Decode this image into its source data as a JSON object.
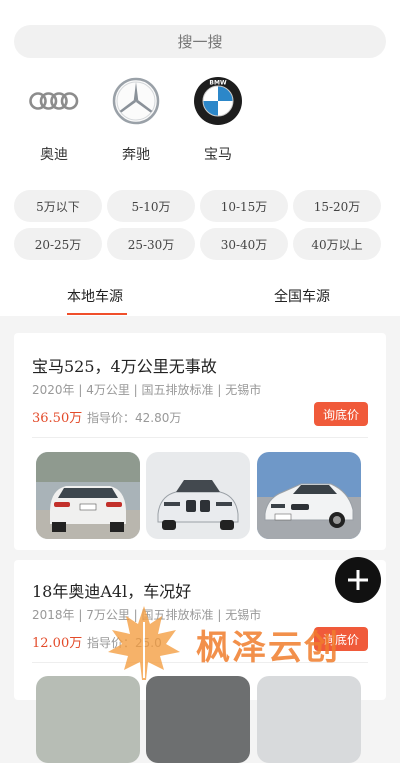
{
  "search": {
    "placeholder": "搜一搜"
  },
  "brands": [
    {
      "name": "奥迪",
      "icon": "audi-logo-icon"
    },
    {
      "name": "奔驰",
      "icon": "mercedes-logo-icon"
    },
    {
      "name": "宝马",
      "icon": "bmw-logo-icon"
    }
  ],
  "price_filters": [
    "5万以下",
    "5-10万",
    "10-15万",
    "15-20万",
    "20-25万",
    "25-30万",
    "30-40万",
    "40万以上"
  ],
  "tabs": [
    {
      "label": "本地车源",
      "active": true
    },
    {
      "label": "全国车源",
      "active": false
    }
  ],
  "listings": [
    {
      "title": "宝马525，4万公里无事故",
      "meta": "2020年 | 4万公里 | 国五排放标准 | 无锡市",
      "price": "36.50万",
      "guide": "指导价：42.80万",
      "action": "询底价"
    },
    {
      "title": "18年奥迪A4l，车况好",
      "meta": "2018年 | 7万公里 | 国五排放标准 | 无锡市",
      "price": "12.00万",
      "guide": "指导价：25.0",
      "action": "询底价"
    }
  ],
  "fab": {
    "icon": "plus-icon"
  },
  "watermark": {
    "text": "枫泽云创"
  },
  "colors": {
    "accent": "#f05a3a",
    "price": "#e34b2a",
    "chip_bg": "#f1f1f1",
    "page_bg": "#f4f4f4"
  }
}
